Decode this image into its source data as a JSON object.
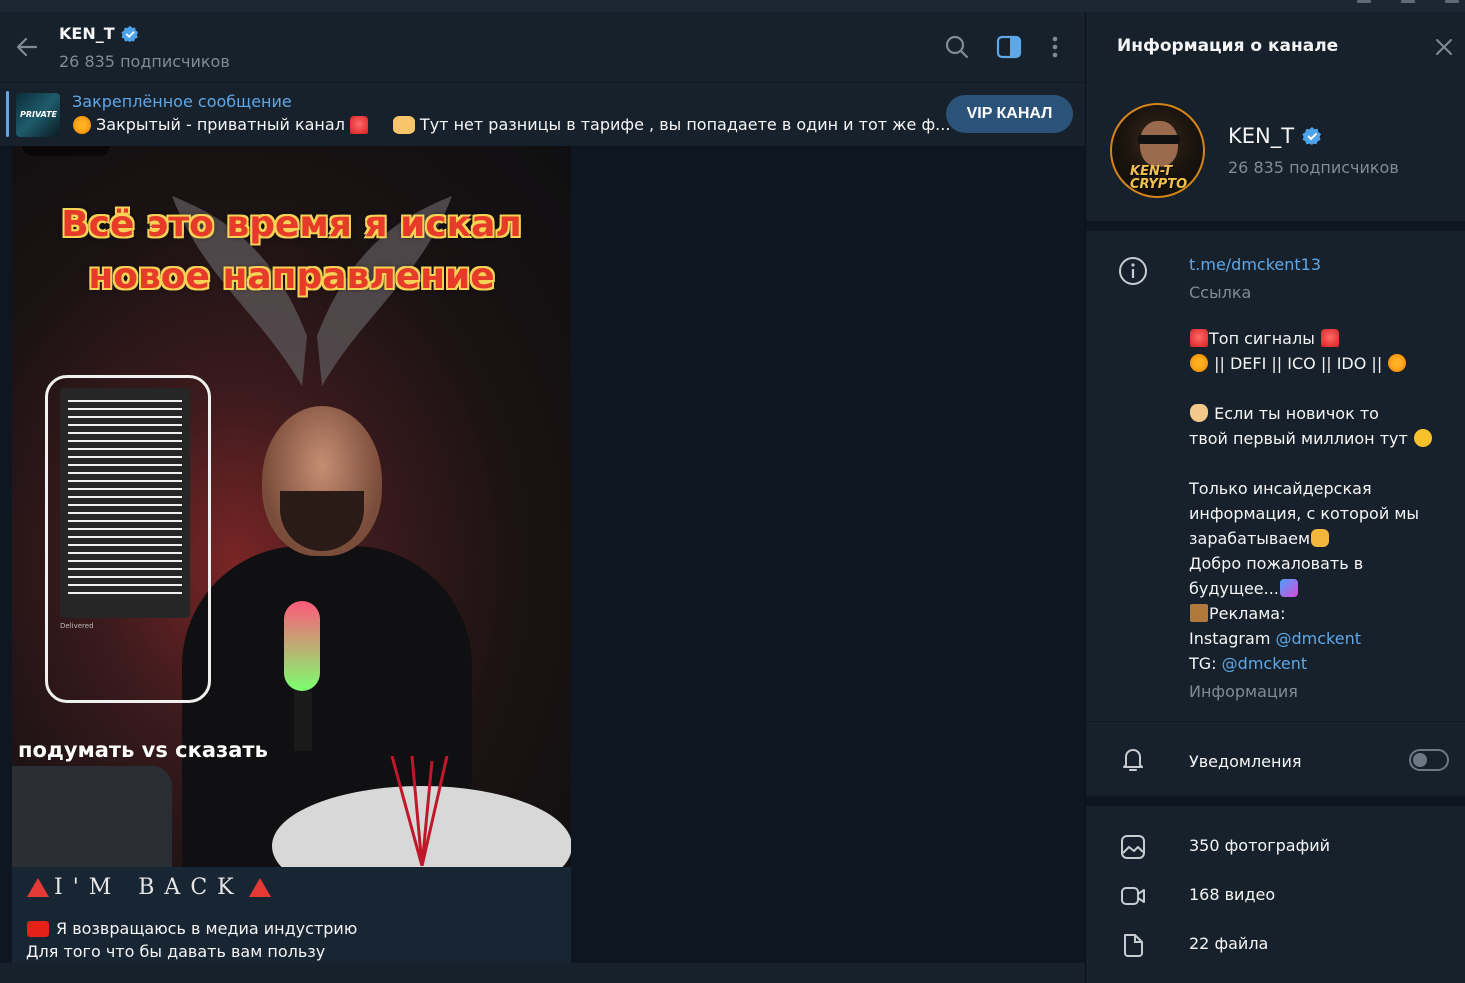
{
  "header": {
    "title": "KEN_T",
    "subscribers": "26 835 подписчиков"
  },
  "pinned": {
    "title": "Закреплённое сообщение",
    "text_part1": "Закрытый - приватный канал",
    "text_part2": "Тут нет разницы в тарифе , вы попадаете в один и тот же ф...",
    "thumb_label": "PRIVATE",
    "button_label": "VIP КАНАЛ"
  },
  "video": {
    "caption_line1": "Всё это время я искал",
    "caption_line2": "новое направление",
    "overlay_text": "подумать vs сказать",
    "phone_status": "Delivered"
  },
  "message": {
    "heading": "I'M BACK",
    "line1": "Я возвращаюсь в медиа индустрию",
    "line2": "Для того что бы давать вам пользу"
  },
  "panel": {
    "title": "Информация о канале",
    "name": "KEN_T",
    "subscribers": "26 835 подписчиков",
    "avatar_text_1": "KEN-T",
    "avatar_text_2": "CRYPTO",
    "link": "t.me/dmckent13",
    "link_caption": "Ссылка",
    "desc": {
      "l1": "Топ сигналы",
      "l2": "|| DEFI || ICO || IDO ||",
      "l3": "Если ты новичок то",
      "l4": "твой первый миллион тут",
      "l5": "Только инсайдерская",
      "l6": "информация, с которой мы",
      "l7": "зарабатываем",
      "l8": "Добро пожаловать в",
      "l9": "будущее...",
      "l10": "Реклама:",
      "l11_prefix": "Instagram",
      "l11_mention": "@dmckent",
      "l12_prefix": "TG:",
      "l12_mention": "@dmckent"
    },
    "info_caption": "Информация",
    "notifications_label": "Уведомления",
    "notifications_on": false,
    "media": {
      "photos": "350 фотографий",
      "videos": "168 видео",
      "files": "22 файла"
    }
  },
  "colors": {
    "accent": "#5ea8e8",
    "bg": "#0e1621",
    "panel": "#17212b",
    "button": "#2b5278"
  },
  "icons": [
    "back-arrow-icon",
    "search-icon",
    "sidebar-toggle-icon",
    "more-vertical-icon",
    "verified-icon",
    "close-icon",
    "info-icon",
    "bell-icon",
    "photo-icon",
    "video-icon",
    "file-icon"
  ]
}
